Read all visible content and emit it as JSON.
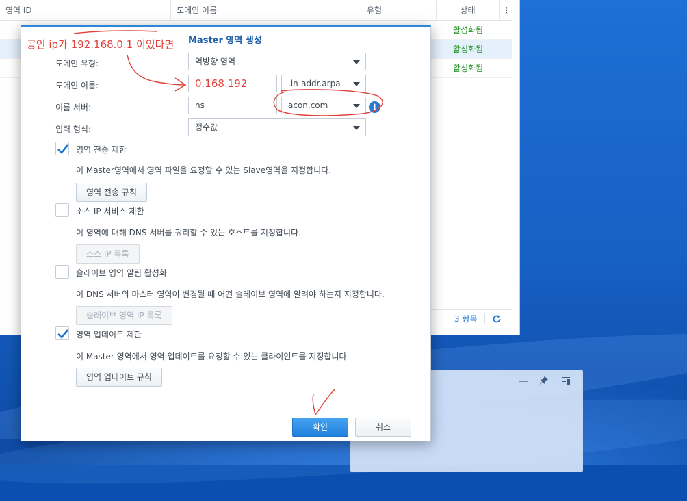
{
  "background_window": {
    "columns": [
      "영역 ID",
      "도메인 이름",
      "유형",
      "상태"
    ],
    "column_menu_icon": "⋮",
    "rows": [
      {
        "status": "활성화됨"
      },
      {
        "status": "활성화됨"
      },
      {
        "status": "활성화됨"
      }
    ],
    "item_count": "3 항목",
    "refresh_icon": "refresh-icon"
  },
  "dialog": {
    "title": "Master 영역 생성",
    "annotation": "공인 ip가 192.168.0.1 이었다면",
    "fields": {
      "domain_type_label": "도메인 유형:",
      "domain_type_value": "역방향 영역",
      "domain_name_label": "도메인 이름:",
      "domain_name_value": "0.168.192",
      "domain_suffix_value": ".in-addr.arpa",
      "name_server_label": "이름 서버:",
      "name_server_value": "ns",
      "name_server_domain_value": "acon.com",
      "input_format_label": "입력 형식:",
      "input_format_value": "정수값"
    },
    "options": [
      {
        "label": "영역 전송 제한",
        "checked": true,
        "description": "이 Master영역에서 영역 파일을 요청할 수 있는 Slave영역을 지정합니다.",
        "button": "영역 전송 규칙",
        "enabled": true
      },
      {
        "label": "소스 IP 서비스 제한",
        "checked": false,
        "description": "이 영역에 대해 DNS 서버를 쿼리할 수 있는 호스트를 지정합니다.",
        "button": "소스 IP 목록",
        "enabled": false
      },
      {
        "label": "슬레이브 영역 알림 활성화",
        "checked": false,
        "description": "이 DNS 서버의 마스터 영역이 변경될 때 어떤 슬레이브 영역에 알려야 하는지 지정합니다.",
        "button": "슬레이브 영역 IP 목록",
        "enabled": false
      },
      {
        "label": "영역 업데이트 제한",
        "checked": true,
        "description": "이 Master 영역에서 영역 업데이트를 요청할 수 있는 클라이언트를 지정합니다.",
        "button": "영역 업데이트 규칙",
        "enabled": true
      }
    ],
    "ok_label": "확인",
    "cancel_label": "취소",
    "info_icon": "i"
  },
  "glass_window": {
    "minimize_icon": "minimize-icon",
    "pin_icon": "pin-icon",
    "layout_icon": "layout-icon"
  },
  "colors": {
    "accent": "#2f86d8",
    "annotation": "#e0413a",
    "status_active": "#1e8f1e",
    "desktop": "#1760c4"
  }
}
